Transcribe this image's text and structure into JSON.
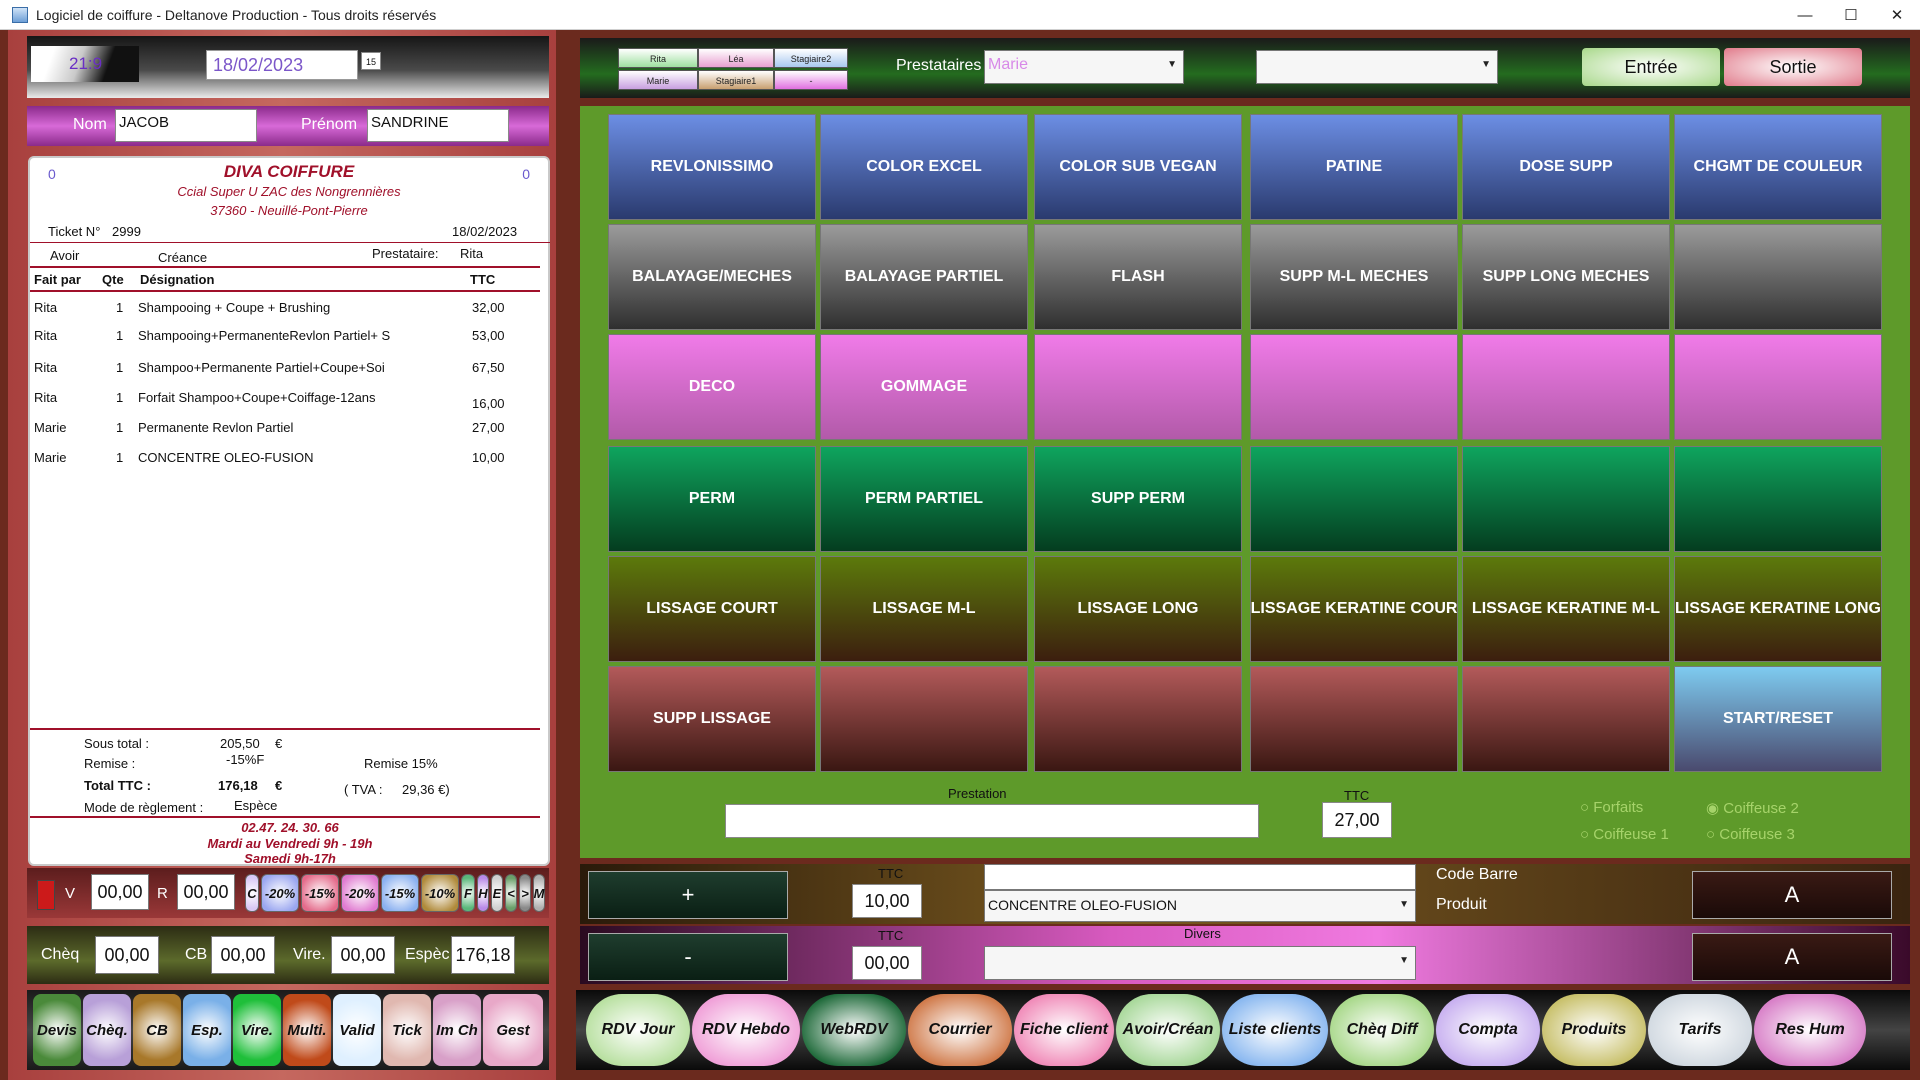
{
  "window": {
    "title": "Logiciel de coiffure - Deltanove Production - Tous droits réservés"
  },
  "topbar": {
    "ratio": "21:9",
    "date": "18/02/2023",
    "calendar_glyph": "15"
  },
  "client": {
    "nom_label": "Nom",
    "nom_value": "JACOB",
    "prenom_label": "Prénom",
    "prenom_value": "SANDRINE"
  },
  "ticket": {
    "left_count": "0",
    "right_count": "0",
    "shop_name": "DIVA COIFFURE",
    "address_line1": "Ccial Super U ZAC des Nongrennières",
    "address_line2": "37360 - Neuillé-Pont-Pierre",
    "ticket_label": "Ticket N°",
    "ticket_number": "2999",
    "ticket_date": "18/02/2023",
    "avoir_label": "Avoir",
    "creance_label": "Créance",
    "prestataire_label": "Prestataire:",
    "prestataire_value": "Rita",
    "headers": {
      "fait_par": "Fait par",
      "qte": "Qte",
      "designation": "Désignation",
      "ttc": "TTC"
    },
    "rows": [
      {
        "fait_par": "Rita",
        "qte": "1",
        "designation": "Shampooing + Coupe + Brushing",
        "ttc": "32,00"
      },
      {
        "fait_par": "Rita",
        "qte": "1",
        "designation": "Shampooing+PermanenteRevlon Partiel+ S",
        "ttc": "53,00"
      },
      {
        "fait_par": "Rita",
        "qte": "1",
        "designation": "Shampoo+Permanente Partiel+Coupe+Soi",
        "ttc": "67,50"
      },
      {
        "fait_par": "Rita",
        "qte": "1",
        "designation": "Forfait Shampoo+Coupe+Coiffage-12ans",
        "ttc": "16,00"
      },
      {
        "fait_par": "Marie",
        "qte": "1",
        "designation": "Permanente Revlon Partiel",
        "ttc": "27,00"
      },
      {
        "fait_par": "Marie",
        "qte": "1",
        "designation": "CONCENTRE OLEO-FUSION",
        "ttc": "10,00"
      }
    ],
    "sous_total_label": "Sous total :",
    "sous_total_value": "205,50",
    "sous_total_currency": "€",
    "remise_label": "Remise :",
    "remise_value": "-15%F",
    "remise_note": "Remise 15%",
    "total_label": "Total TTC :",
    "total_value": "176,18",
    "total_currency": "€",
    "tva_label": "( TVA :",
    "tva_value": "29,36 €)",
    "mode_label": "Mode de règlement :",
    "mode_value": "Espèce",
    "phone": "02.47. 24. 30. 66",
    "hours1": "Mardi au Vendredi 9h  -  19h",
    "hours2": "Samedi  9h-17h"
  },
  "reductions": {
    "v_label": "V",
    "v_value": "00,00",
    "r_label": "R",
    "r_value": "00,00",
    "buttons": [
      {
        "label": "C",
        "color": "#d9c8f5"
      },
      {
        "label": "-20%",
        "color": "#9aa6f0"
      },
      {
        "label": "-15%",
        "color": "#e46a8a"
      },
      {
        "label": "-20%",
        "color": "#e07ad0"
      },
      {
        "label": "-15%",
        "color": "#8ab0f0"
      },
      {
        "label": "-10%",
        "color": "#b08a3a"
      },
      {
        "label": "F",
        "color": "#5ab87a"
      },
      {
        "label": "H",
        "color": "#b98ae8"
      },
      {
        "label": "E",
        "color": "#d0d0d0"
      },
      {
        "label": "<",
        "color": "#6aa06a"
      },
      {
        "label": ">",
        "color": "#8a8a8a"
      },
      {
        "label": "M",
        "color": "#b0b0b0"
      }
    ]
  },
  "payments": {
    "cheq_label": "Chèq",
    "cheq_value": "00,00",
    "cb_label": "CB",
    "cb_value": "00,00",
    "vire_label": "Vire.",
    "vire_value": "00,00",
    "espec_label": "Espèc",
    "espec_value": "176,18"
  },
  "function_buttons": [
    {
      "label": "Devis",
      "color": "#4a8a3a"
    },
    {
      "label": "Chèq.",
      "color": "#b8a0d8"
    },
    {
      "label": "CB",
      "color": "#a8782a"
    },
    {
      "label": "Esp.",
      "color": "#7ab0e8"
    },
    {
      "label": "Vire.",
      "color": "#1fbf3a"
    },
    {
      "label": "Multi.",
      "color": "#c04a1a"
    },
    {
      "label": "Valid",
      "color": "#dff0ff"
    },
    {
      "label": "Tick",
      "color": "#e0b8b0"
    },
    {
      "label": "Im Ch",
      "color": "#d8a0c8"
    },
    {
      "label": "Gest",
      "color": "#e8a8c8"
    }
  ],
  "staff": [
    {
      "label": "Rita",
      "color": "#9fe0a0"
    },
    {
      "label": "Léa",
      "color": "#e8a0d0"
    },
    {
      "label": "Stagiaire2",
      "color": "#a8c8f0"
    },
    {
      "label": "Marie",
      "color": "#c8a0e0"
    },
    {
      "label": "Stagiaire1",
      "color": "#c8a070"
    },
    {
      "label": "-",
      "color": "#e070e0"
    }
  ],
  "prestataires": {
    "label": "Prestataires",
    "value": "Marie",
    "second_value": ""
  },
  "entry_exit": {
    "entree": "Entrée",
    "sortie": "Sortie"
  },
  "services": [
    [
      {
        "label": "REVLONISSIMO",
        "c": "c-blue"
      },
      {
        "label": "COLOR EXCEL",
        "c": "c-blue"
      },
      {
        "label": "COLOR SUB VEGAN",
        "c": "c-blue"
      },
      {
        "label": "PATINE",
        "c": "c-blue"
      },
      {
        "label": "DOSE SUPP",
        "c": "c-blue"
      },
      {
        "label": "CHGMT DE COULEUR",
        "c": "c-blue"
      }
    ],
    [
      {
        "label": "BALAYAGE/MECHES",
        "c": "c-gray"
      },
      {
        "label": "BALAYAGE PARTIEL",
        "c": "c-gray"
      },
      {
        "label": "FLASH",
        "c": "c-gray"
      },
      {
        "label": "SUPP M-L MECHES",
        "c": "c-gray"
      },
      {
        "label": "SUPP LONG MECHES",
        "c": "c-gray"
      },
      {
        "label": "",
        "c": "c-gray"
      }
    ],
    [
      {
        "label": "DECO",
        "c": "c-pink"
      },
      {
        "label": "GOMMAGE",
        "c": "c-pink"
      },
      {
        "label": "",
        "c": "c-pink"
      },
      {
        "label": "",
        "c": "c-pink"
      },
      {
        "label": "",
        "c": "c-pink"
      },
      {
        "label": "",
        "c": "c-pink"
      }
    ],
    [
      {
        "label": "PERM",
        "c": "c-green"
      },
      {
        "label": "PERM PARTIEL",
        "c": "c-green"
      },
      {
        "label": "SUPP PERM",
        "c": "c-green"
      },
      {
        "label": "",
        "c": "c-green"
      },
      {
        "label": "",
        "c": "c-green"
      },
      {
        "label": "",
        "c": "c-green"
      }
    ],
    [
      {
        "label": "LISSAGE COURT",
        "c": "c-olive"
      },
      {
        "label": "LISSAGE M-L",
        "c": "c-olive"
      },
      {
        "label": "LISSAGE LONG",
        "c": "c-olive"
      },
      {
        "label": "LISSAGE KERATINE COUR",
        "c": "c-olive"
      },
      {
        "label": "LISSAGE KERATINE M-L",
        "c": "c-olive"
      },
      {
        "label": "LISSAGE KERATINE LONG",
        "c": "c-olive"
      }
    ],
    [
      {
        "label": "SUPP LISSAGE",
        "c": "c-brown"
      },
      {
        "label": "",
        "c": "c-brown"
      },
      {
        "label": "",
        "c": "c-brown"
      },
      {
        "label": "",
        "c": "c-brown"
      },
      {
        "label": "",
        "c": "c-brown"
      },
      {
        "label": "START/RESET",
        "c": "c-start"
      }
    ]
  ],
  "prestation": {
    "label": "Prestation",
    "value": "",
    "ttc_label": "TTC",
    "ttc_value": "27,00",
    "radios": [
      {
        "label": "Forfaits"
      },
      {
        "label": "Coiffeuse 2"
      },
      {
        "label": "Coiffeuse 1"
      },
      {
        "label": "Coiffeuse 3"
      }
    ]
  },
  "product": {
    "plus": "+",
    "ttc_label": "TTC",
    "ttc_value": "10,00",
    "barcode_value": "",
    "product_value": "CONCENTRE OLEO-FUSION",
    "code_barre_label": "Code Barre",
    "produit_label": "Produit",
    "a_label": "A"
  },
  "divers": {
    "minus": "-",
    "ttc_label": "TTC",
    "ttc_value": "00,00",
    "label": "Divers",
    "value": "",
    "a_label": "A"
  },
  "nav_buttons": [
    {
      "label": "RDV Jour",
      "color": "#b8e0a0"
    },
    {
      "label": "RDV Hebdo",
      "color": "#f0a0d8"
    },
    {
      "label": "WebRDV",
      "color": "#1f6a3a"
    },
    {
      "label": "Courrier",
      "color": "#d07a4a"
    },
    {
      "label": "Fiche client",
      "color": "#f08ab8"
    },
    {
      "label": "Avoir/Créan",
      "color": "#a8d89a"
    },
    {
      "label": "Liste clients",
      "color": "#8ab8f0"
    },
    {
      "label": "Chèq Diff",
      "color": "#a8d88a"
    },
    {
      "label": "Compta",
      "color": "#c8b0f0"
    },
    {
      "label": "Produits",
      "color": "#c8c06a"
    },
    {
      "label": "Tarifs",
      "color": "#d0d8e0"
    },
    {
      "label": "Res Hum",
      "color": "#d880c8"
    }
  ]
}
